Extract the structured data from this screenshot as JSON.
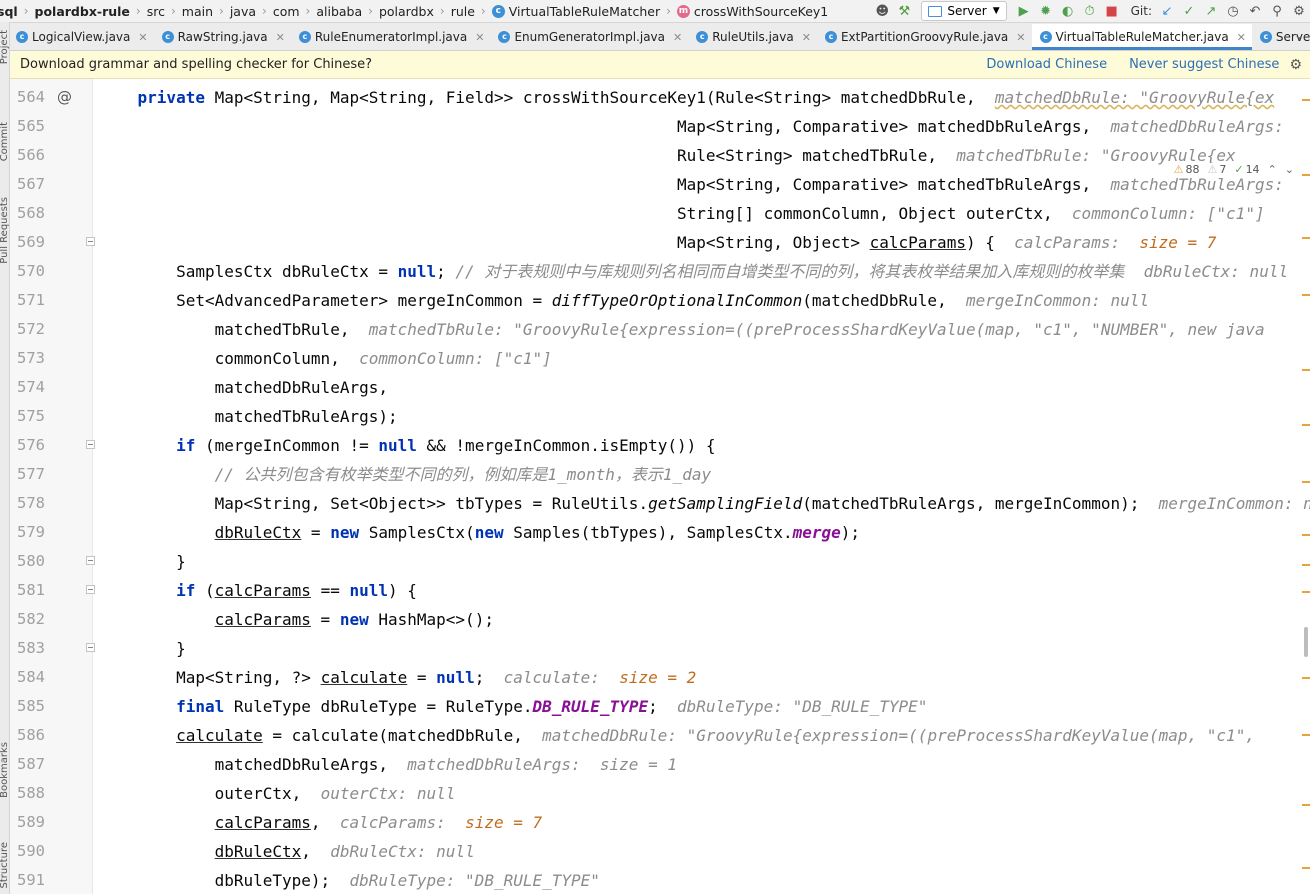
{
  "breadcrumb": [
    {
      "text": "sql",
      "bold": true
    },
    {
      "text": "polardbx-rule",
      "bold": true
    },
    {
      "text": "src"
    },
    {
      "text": "main"
    },
    {
      "text": "java"
    },
    {
      "text": "com"
    },
    {
      "text": "alibaba"
    },
    {
      "text": "polardbx"
    },
    {
      "text": "rule"
    },
    {
      "text": "VirtualTableRuleMatcher",
      "icon": "class-icon"
    },
    {
      "text": "crossWithSourceKey1",
      "icon": "method-icon"
    }
  ],
  "toolbar": {
    "run_config": "Server",
    "git_label": "Git:"
  },
  "tabs": [
    {
      "label": "LogicalView.java",
      "active": false
    },
    {
      "label": "RawString.java",
      "active": false
    },
    {
      "label": "RuleEnumeratorImpl.java",
      "active": false
    },
    {
      "label": "EnumGeneratorImpl.java",
      "active": false
    },
    {
      "label": "RuleUtils.java",
      "active": false
    },
    {
      "label": "ExtPartitionGroovyRule.java",
      "active": false
    },
    {
      "label": "VirtualTableRuleMatcher.java",
      "active": true
    },
    {
      "label": "ServerConnec",
      "active": false,
      "truncated": true
    }
  ],
  "side_stripe": {
    "project": "Project",
    "commit": "Commit",
    "pull_requests": "Pull Requests",
    "bookmarks": "Bookmarks",
    "structure": "Structure"
  },
  "notification": {
    "message": "Download grammar and spelling checker for Chinese?",
    "action_download": "Download Chinese",
    "action_never": "Never suggest Chinese"
  },
  "inspections": {
    "warnings": "88",
    "weak_warnings": "7",
    "typos": "14"
  },
  "code_lines": [
    {
      "n": "564",
      "mark": "@",
      "indent": 1,
      "segs": [
        [
          "kw",
          "private "
        ],
        [
          "",
          "Map<String, Map<String, Field>> crossWithSourceKey1(Rule<String> matchedDbRule,  "
        ],
        [
          "hint",
          "matchedDbRule: \"GroovyRule{ex"
        ]
      ]
    },
    {
      "n": "565",
      "indent": 0,
      "pad": 60,
      "segs": [
        [
          "",
          "Map<String, Comparative> matchedDbRuleArgs,  "
        ],
        [
          "hint",
          "matchedDbRuleArgs:"
        ]
      ]
    },
    {
      "n": "566",
      "indent": 0,
      "pad": 60,
      "segs": [
        [
          "",
          "Rule<String> matchedTbRule,  "
        ],
        [
          "hint",
          "matchedTbRule: \"GroovyRule{ex"
        ]
      ]
    },
    {
      "n": "567",
      "indent": 0,
      "pad": 60,
      "segs": [
        [
          "",
          "Map<String, Comparative> matchedTbRuleArgs,  "
        ],
        [
          "hint",
          "matchedTbRuleArgs:"
        ]
      ]
    },
    {
      "n": "568",
      "indent": 0,
      "pad": 60,
      "segs": [
        [
          "",
          "String[] commonColumn, Object outerCtx,  "
        ],
        [
          "hint",
          "commonColumn: [\"c1\"]"
        ]
      ]
    },
    {
      "n": "569",
      "indent": 0,
      "pad": 60,
      "fold": true,
      "segs": [
        [
          "",
          "Map<String, Object> "
        ],
        [
          "ul",
          "calcParams"
        ],
        [
          "",
          ") {  "
        ],
        [
          "hint",
          "calcParams:  "
        ],
        [
          "hnum",
          "size = 7"
        ]
      ]
    },
    {
      "n": "570",
      "indent": 2,
      "segs": [
        [
          "",
          "SamplesCtx dbRuleCtx = "
        ],
        [
          "kw",
          "null"
        ],
        [
          "",
          "; "
        ],
        [
          "cmt",
          "// 对于表规则中与库规则列名相同而自增类型不同的列，将其表枚举结果加入库规则的枚举集  "
        ],
        [
          "hint",
          "dbRuleCtx: null"
        ]
      ]
    },
    {
      "n": "571",
      "indent": 2,
      "segs": [
        [
          "",
          "Set<AdvancedParameter> mergeInCommon = "
        ],
        [
          "it",
          "diffTypeOrOptionalInCommon"
        ],
        [
          "",
          "(matchedDbRule,  "
        ],
        [
          "hint",
          "mergeInCommon: null"
        ]
      ]
    },
    {
      "n": "572",
      "indent": 3,
      "segs": [
        [
          "",
          "matchedTbRule,  "
        ],
        [
          "hint",
          "matchedTbRule: \"GroovyRule{expression=((preProcessShardKeyValue(map, \"c1\", \"NUMBER\", new java"
        ]
      ]
    },
    {
      "n": "573",
      "indent": 3,
      "segs": [
        [
          "",
          "commonColumn,  "
        ],
        [
          "hint",
          "commonColumn: [\"c1\"]"
        ]
      ]
    },
    {
      "n": "574",
      "indent": 3,
      "segs": [
        [
          "",
          "matchedDbRuleArgs,"
        ]
      ]
    },
    {
      "n": "575",
      "indent": 3,
      "segs": [
        [
          "",
          "matchedTbRuleArgs);"
        ]
      ]
    },
    {
      "n": "576",
      "indent": 2,
      "fold": true,
      "segs": [
        [
          "kw",
          "if "
        ],
        [
          "",
          "(mergeInCommon != "
        ],
        [
          "kw",
          "null"
        ],
        [
          "",
          " && !mergeInCommon.isEmpty()) {"
        ]
      ]
    },
    {
      "n": "577",
      "indent": 3,
      "segs": [
        [
          "cmt",
          "// 公共列包含有枚举类型不同的列，例如库是1_month，表示1_day"
        ]
      ]
    },
    {
      "n": "578",
      "indent": 3,
      "segs": [
        [
          "",
          "Map<String, Set<Object>> tbTypes = RuleUtils."
        ],
        [
          "it",
          "getSamplingField"
        ],
        [
          "",
          "(matchedTbRuleArgs, mergeInCommon);  "
        ],
        [
          "hint",
          "mergeInCommon: null"
        ]
      ]
    },
    {
      "n": "579",
      "indent": 3,
      "segs": [
        [
          "ul",
          "dbRuleCtx"
        ],
        [
          "",
          " = "
        ],
        [
          "kw",
          "new "
        ],
        [
          "",
          "SamplesCtx("
        ],
        [
          "kw",
          "new "
        ],
        [
          "",
          "Samples(tbTypes), SamplesCtx."
        ],
        [
          "cst",
          "merge"
        ],
        [
          "",
          ");"
        ]
      ]
    },
    {
      "n": "580",
      "indent": 2,
      "fold": true,
      "segs": [
        [
          "",
          "}"
        ]
      ]
    },
    {
      "n": "581",
      "indent": 2,
      "fold": true,
      "segs": [
        [
          "kw",
          "if "
        ],
        [
          "",
          "("
        ],
        [
          "ul",
          "calcParams"
        ],
        [
          "",
          " == "
        ],
        [
          "kw",
          "null"
        ],
        [
          "",
          ") {"
        ]
      ]
    },
    {
      "n": "582",
      "indent": 3,
      "segs": [
        [
          "ul",
          "calcParams"
        ],
        [
          "",
          " = "
        ],
        [
          "kw",
          "new "
        ],
        [
          "",
          "HashMap<>();"
        ]
      ]
    },
    {
      "n": "583",
      "indent": 2,
      "fold": true,
      "segs": [
        [
          "",
          "}"
        ]
      ]
    },
    {
      "n": "584",
      "indent": 2,
      "segs": [
        [
          "",
          "Map<String, ?> "
        ],
        [
          "ul",
          "calculate"
        ],
        [
          "",
          " = "
        ],
        [
          "kw",
          "null"
        ],
        [
          "",
          ";  "
        ],
        [
          "hint",
          "calculate:  "
        ],
        [
          "hnum",
          "size = 2"
        ]
      ]
    },
    {
      "n": "585",
      "indent": 2,
      "segs": [
        [
          "kw",
          "final "
        ],
        [
          "",
          "RuleType dbRuleType = RuleType."
        ],
        [
          "cst",
          "DB_RULE_TYPE"
        ],
        [
          "",
          ";  "
        ],
        [
          "hint",
          "dbRuleType: \"DB_RULE_TYPE\""
        ]
      ]
    },
    {
      "n": "586",
      "indent": 2,
      "segs": [
        [
          "ul",
          "calculate"
        ],
        [
          "",
          " = calculate(matchedDbRule,  "
        ],
        [
          "hint",
          "matchedDbRule: \"GroovyRule{expression=((preProcessShardKeyValue(map, \"c1\","
        ]
      ]
    },
    {
      "n": "587",
      "indent": 3,
      "segs": [
        [
          "",
          "matchedDbRuleArgs,  "
        ],
        [
          "hint",
          "matchedDbRuleArgs:  size = 1"
        ]
      ]
    },
    {
      "n": "588",
      "indent": 3,
      "segs": [
        [
          "",
          "outerCtx,  "
        ],
        [
          "hint",
          "outerCtx: null"
        ]
      ]
    },
    {
      "n": "589",
      "indent": 3,
      "segs": [
        [
          "ul",
          "calcParams"
        ],
        [
          "",
          ",  "
        ],
        [
          "hint",
          "calcParams:  "
        ],
        [
          "hnum",
          "size = 7"
        ]
      ]
    },
    {
      "n": "590",
      "indent": 3,
      "segs": [
        [
          "ul",
          "dbRuleCtx"
        ],
        [
          "",
          ",  "
        ],
        [
          "hint",
          "dbRuleCtx: null"
        ]
      ]
    },
    {
      "n": "591",
      "indent": 3,
      "segs": [
        [
          "",
          "dbRuleType);  "
        ],
        [
          "hint",
          "dbRuleType: \"DB_RULE_TYPE\""
        ]
      ]
    }
  ]
}
